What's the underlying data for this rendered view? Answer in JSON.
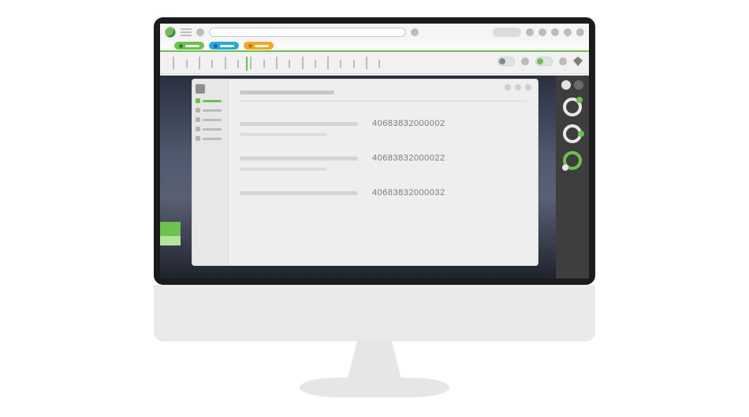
{
  "colors": {
    "accent": "#6cc24a",
    "blue": "#2aa7e1",
    "orange": "#f5a623"
  },
  "tags": [
    {
      "color": "green"
    },
    {
      "color": "blue"
    },
    {
      "color": "orange"
    }
  ],
  "ruler": {
    "ticks": [
      3,
      6,
      9,
      12,
      15,
      18,
      21,
      24,
      27,
      30,
      33,
      36,
      39,
      42,
      45,
      48,
      51
    ],
    "long": [
      0,
      2,
      4,
      6,
      8,
      10,
      12,
      15
    ],
    "green": 20
  },
  "siderail": {
    "rings": [
      {
        "name": "ring-1",
        "pos": "tr"
      },
      {
        "name": "ring-2",
        "pos": "right"
      },
      {
        "name": "ring-3",
        "pos": "br",
        "active": true
      }
    ]
  },
  "window": {
    "rows": [
      {
        "value": "40683832000002"
      },
      {
        "value": "40683832000022"
      },
      {
        "value": "40683832000032"
      }
    ]
  }
}
